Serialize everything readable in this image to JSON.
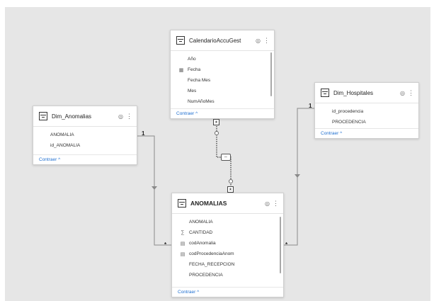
{
  "tables": {
    "calendario": {
      "title": "CalendarioAccuGest",
      "fields": [
        {
          "label": "Año",
          "icon": ""
        },
        {
          "label": "Fecha",
          "icon": "calendar-icon"
        },
        {
          "label": "Fecha Mes",
          "icon": ""
        },
        {
          "label": "Mes",
          "icon": ""
        },
        {
          "label": "NumAñoMes",
          "icon": ""
        }
      ],
      "collapse_label": "Contraer ^"
    },
    "hospitales": {
      "title": "Dim_Hospitales",
      "fields": [
        {
          "label": "id_procedencia",
          "icon": ""
        },
        {
          "label": "PROCEDENCIA",
          "icon": ""
        }
      ],
      "collapse_label": "Contraer ^"
    },
    "anomalias_dim": {
      "title": "Dim_Anomalias",
      "fields": [
        {
          "label": "ANOMALIA",
          "icon": ""
        },
        {
          "label": "id_ANOMALIA",
          "icon": ""
        }
      ],
      "collapse_label": "Contraer ^"
    },
    "anomalias": {
      "title": "ANOMALIAS",
      "fields": [
        {
          "label": "ANOMALIA",
          "icon": ""
        },
        {
          "label": "CANTIDAD",
          "icon": "sigma-icon"
        },
        {
          "label": "codAnomalia",
          "icon": "calc-icon"
        },
        {
          "label": "codProcedenciaAnom",
          "icon": "calc-icon"
        },
        {
          "label": "FECHA_RECEPCION",
          "icon": ""
        },
        {
          "label": "PROCEDENCIA",
          "icon": ""
        }
      ],
      "collapse_label": "Contraer ^"
    }
  },
  "relationships": {
    "one_label": "1",
    "many_label": "*"
  },
  "icons": {
    "eye": "◎",
    "more": "⋮"
  },
  "colors": {
    "canvas": "#e6e6e6",
    "link": "#1f6fd0",
    "line": "#8a8a8a"
  }
}
